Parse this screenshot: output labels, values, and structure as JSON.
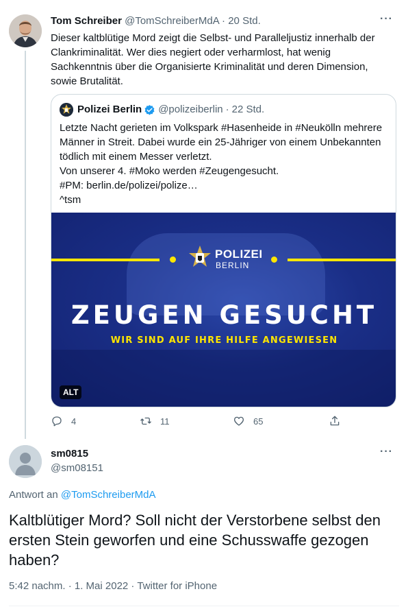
{
  "quoted_parent_tweet": {
    "author": {
      "name": "Tom Schreiber",
      "handle": "@TomSchreiberMdA"
    },
    "separator": "·",
    "time": "20 Std.",
    "more": "···",
    "text": "Dieser kaltblütige Mord zeigt die Selbst- und Paralleljustiz innerhalb der Clankriminalität. Wer dies negiert oder verharmlost, hat wenig Sachkenntnis über die Organisierte Kriminalität und deren Dimension, sowie Brutalität.",
    "quote": {
      "author": {
        "name": "Polizei Berlin",
        "handle": "@polizeiberlin",
        "verified": true
      },
      "separator": "·",
      "time": "22 Std.",
      "text_lines": [
        "Letzte Nacht gerieten im Volkspark #Hasenheide in #Neukölln mehrere Männer in Streit. Dabei wurde ein 25-Jähriger von einem Unbekannten tödlich mit einem Messer verletzt.",
        "Von unserer 4. #Moko werden #Zeugengesucht.",
        "#PM: berlin.de/polizei/polize…",
        "^tsm"
      ],
      "media": {
        "logo_line1": "POLIZEI",
        "logo_line2": "BERLIN",
        "headline": "ZEUGEN GESUCHT",
        "subline": "WIR SIND AUF IHRE HILFE ANGEWIESEN",
        "alt_badge": "ALT",
        "colors": {
          "background": "#1a2e86",
          "accent": "#ffe600"
        }
      }
    },
    "actions": {
      "reply_count": "4",
      "retweet_count": "11",
      "like_count": "65"
    }
  },
  "main_tweet": {
    "author": {
      "name": "sm0815",
      "handle": "@sm08151"
    },
    "more": "···",
    "reply_prefix": "Antwort an",
    "reply_to": "@TomSchreiberMdA",
    "text": "Kaltblütiger Mord? Soll nicht der Verstorbene selbst den ersten Stein geworfen und eine Schusswaffe gezogen haben?",
    "meta": "5:42 nachm. · 1. Mai 2022 · Twitter for iPhone"
  },
  "colors": {
    "link": "#1d9bf0",
    "secondary_text": "#536471",
    "border": "#cfd9de"
  }
}
